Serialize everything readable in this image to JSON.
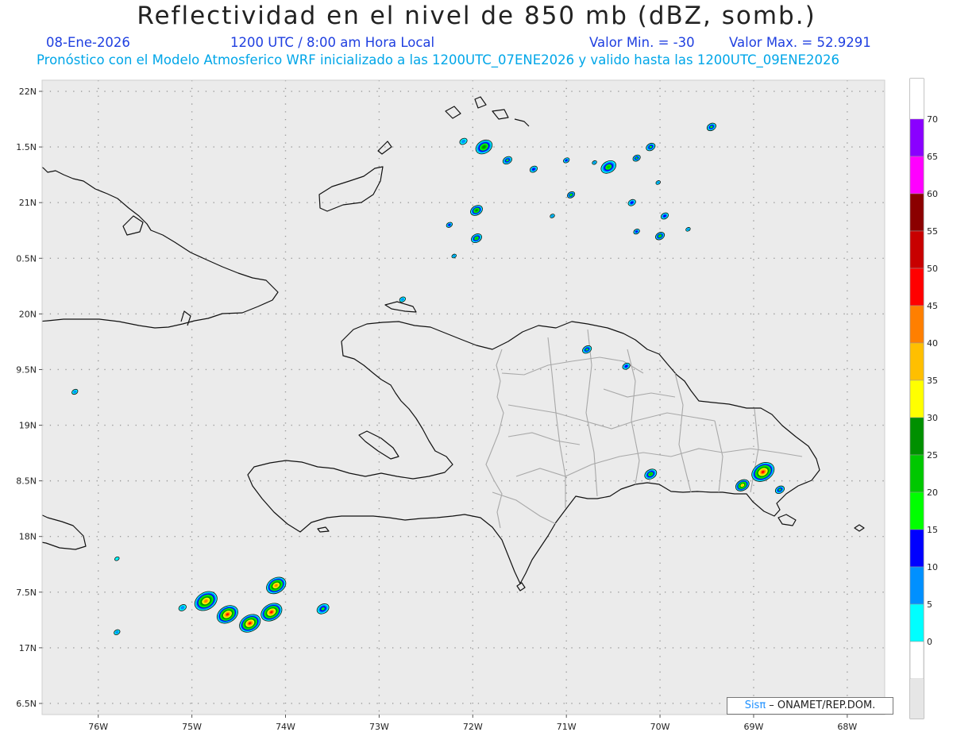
{
  "header": {
    "title": "Reflectividad en el nivel de 850 mb (dBZ, somb.)",
    "date": "08-Ene-2026",
    "time": "1200 UTC / 8:00 am Hora Local",
    "min_value": "Valor Min. = -30",
    "max_value": "Valor Max. = 52.9291",
    "forecast_info": "Pronóstico con el Modelo Atmosferico WRF inicializado a las 1200UTC_07ENE2026 y valido hasta las  1200UTC_09ENE2026"
  },
  "map": {
    "lon_range": [
      -76.6,
      -67.6
    ],
    "lat_range": [
      16.4,
      22.1
    ],
    "lat_ticks": [
      {
        "value": 22,
        "label": "22N"
      },
      {
        "value": 21.5,
        "label": "1.5N"
      },
      {
        "value": 21,
        "label": "21N"
      },
      {
        "value": 20.5,
        "label": "0.5N"
      },
      {
        "value": 20,
        "label": "20N"
      },
      {
        "value": 19.5,
        "label": "9.5N"
      },
      {
        "value": 19,
        "label": "19N"
      },
      {
        "value": 18.5,
        "label": "8.5N"
      },
      {
        "value": 18,
        "label": "18N"
      },
      {
        "value": 17.5,
        "label": "7.5N"
      },
      {
        "value": 17,
        "label": "17N"
      },
      {
        "value": 16.5,
        "label": "6.5N"
      }
    ],
    "lon_ticks": [
      {
        "value": -76,
        "label": "76W"
      },
      {
        "value": -75,
        "label": "75W"
      },
      {
        "value": -74,
        "label": "74W"
      },
      {
        "value": -73,
        "label": "73W"
      },
      {
        "value": -72,
        "label": "72W"
      },
      {
        "value": -71,
        "label": "71W"
      },
      {
        "value": -70,
        "label": "70W"
      },
      {
        "value": -69,
        "label": "69W"
      },
      {
        "value": -68,
        "label": "68W"
      }
    ],
    "colors": {
      "background": "#ebebeb",
      "coast": "#111111",
      "provinces": "#a8a8a8",
      "grid": "#9a9a9a"
    }
  },
  "legend": {
    "levels": [
      {
        "label": "70",
        "color": "#8a00ff"
      },
      {
        "label": "65",
        "color": "#ff00ff"
      },
      {
        "label": "60",
        "color": "#8b0000"
      },
      {
        "label": "55",
        "color": "#c80000"
      },
      {
        "label": "50",
        "color": "#ff0000"
      },
      {
        "label": "45",
        "color": "#ff7f00"
      },
      {
        "label": "40",
        "color": "#ffbf00"
      },
      {
        "label": "35",
        "color": "#ffff00"
      },
      {
        "label": "30",
        "color": "#009000"
      },
      {
        "label": "25",
        "color": "#00c800"
      },
      {
        "label": "20",
        "color": "#00ff00"
      },
      {
        "label": "15",
        "color": "#0000ff"
      },
      {
        "label": "10",
        "color": "#0090ff"
      },
      {
        "label": "5",
        "color": "#00ffff"
      },
      {
        "label": "0",
        "color": "#ffffff"
      }
    ],
    "bottom_color": "#e6e6e6"
  },
  "echoes": [
    {
      "lon": -74.85,
      "lat": 17.42,
      "r": 15,
      "max": 45
    },
    {
      "lon": -74.62,
      "lat": 17.3,
      "r": 14,
      "max": 50
    },
    {
      "lon": -74.38,
      "lat": 17.22,
      "r": 14,
      "max": 52
    },
    {
      "lon": -74.15,
      "lat": 17.32,
      "r": 14,
      "max": 50
    },
    {
      "lon": -74.1,
      "lat": 17.56,
      "r": 13,
      "max": 45
    },
    {
      "lon": -73.6,
      "lat": 17.35,
      "r": 8,
      "max": 20
    },
    {
      "lon": -75.1,
      "lat": 17.36,
      "r": 5,
      "max": 10
    },
    {
      "lon": -75.8,
      "lat": 17.14,
      "r": 4,
      "max": 10
    },
    {
      "lon": -75.8,
      "lat": 17.8,
      "r": 3,
      "max": 5
    },
    {
      "lon": -76.25,
      "lat": 19.3,
      "r": 4,
      "max": 10
    },
    {
      "lon": -72.75,
      "lat": 20.13,
      "r": 4,
      "max": 10
    },
    {
      "lon": -68.9,
      "lat": 18.58,
      "r": 15,
      "max": 50
    },
    {
      "lon": -69.12,
      "lat": 18.46,
      "r": 9,
      "max": 40
    },
    {
      "lon": -68.72,
      "lat": 18.42,
      "r": 6,
      "max": 20
    },
    {
      "lon": -70.1,
      "lat": 18.56,
      "r": 8,
      "max": 25
    },
    {
      "lon": -70.36,
      "lat": 19.53,
      "r": 5,
      "max": 15
    },
    {
      "lon": -70.78,
      "lat": 19.68,
      "r": 6,
      "max": 20
    },
    {
      "lon": -71.88,
      "lat": 21.5,
      "r": 11,
      "max": 30
    },
    {
      "lon": -71.96,
      "lat": 20.93,
      "r": 8,
      "max": 30
    },
    {
      "lon": -71.96,
      "lat": 20.68,
      "r": 7,
      "max": 25
    },
    {
      "lon": -71.63,
      "lat": 21.38,
      "r": 6,
      "max": 20
    },
    {
      "lon": -71.35,
      "lat": 21.3,
      "r": 5,
      "max": 15
    },
    {
      "lon": -72.1,
      "lat": 21.55,
      "r": 5,
      "max": 10
    },
    {
      "lon": -70.55,
      "lat": 21.32,
      "r": 10,
      "max": 25
    },
    {
      "lon": -70.1,
      "lat": 21.5,
      "r": 6,
      "max": 20
    },
    {
      "lon": -70.25,
      "lat": 21.4,
      "r": 5,
      "max": 20
    },
    {
      "lon": -70.3,
      "lat": 21.0,
      "r": 5,
      "max": 15
    },
    {
      "lon": -70.0,
      "lat": 20.7,
      "r": 6,
      "max": 25
    },
    {
      "lon": -69.95,
      "lat": 20.88,
      "r": 5,
      "max": 15
    },
    {
      "lon": -69.45,
      "lat": 21.68,
      "r": 6,
      "max": 20
    },
    {
      "lon": -70.95,
      "lat": 21.07,
      "r": 5,
      "max": 25
    },
    {
      "lon": -71.0,
      "lat": 21.38,
      "r": 4,
      "max": 15
    },
    {
      "lon": -70.02,
      "lat": 21.18,
      "r": 3,
      "max": 10
    },
    {
      "lon": -70.25,
      "lat": 20.74,
      "r": 4,
      "max": 15
    },
    {
      "lon": -69.7,
      "lat": 20.76,
      "r": 3,
      "max": 10
    },
    {
      "lon": -72.25,
      "lat": 20.8,
      "r": 4,
      "max": 15
    },
    {
      "lon": -72.2,
      "lat": 20.52,
      "r": 3,
      "max": 10
    },
    {
      "lon": -71.15,
      "lat": 20.88,
      "r": 3,
      "max": 10
    },
    {
      "lon": -70.7,
      "lat": 21.36,
      "r": 3,
      "max": 10
    }
  ],
  "credit": {
    "logo": "Sisπ",
    "text": " – ONAMET/REP.DOM."
  }
}
